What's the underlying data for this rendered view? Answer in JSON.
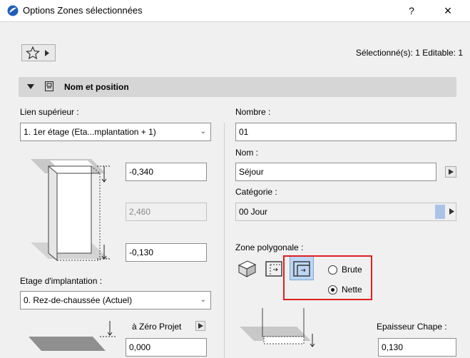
{
  "window": {
    "title": "Options Zones sélectionnées",
    "help": "?",
    "close": "×"
  },
  "toolbar": {
    "selection_info": "Sélectionné(s): 1 Editable: 1"
  },
  "section": {
    "title": "Nom et position"
  },
  "left": {
    "top_link_label": "Lien supérieur :",
    "top_link_value": "1. 1er étage (Eta...mplantation + 1)",
    "top_offset": "-0,340",
    "height": "2,460",
    "bottom_offset": "-0,130",
    "home_story_label": "Etage d'implantation :",
    "home_story_value": "0. Rez-de-chaussée (Actuel)",
    "to_zero_label": "à Zéro Projet",
    "to_zero_value": "0,000"
  },
  "right": {
    "number_label": "Nombre :",
    "number_value": "01",
    "name_label": "Nom :",
    "name_value": "Séjour",
    "category_label": "Catégorie :",
    "category_value": "00  Jour",
    "polygon_label": "Zone polygonale :",
    "radio_brute": "Brute",
    "radio_nette": "Nette",
    "screed_label": "Epaisseur Chape :",
    "screed_value": "0,130"
  },
  "colors": {
    "accent_highlight": "#bcd6f3",
    "callout_red": "#e02020",
    "category_swatch": "#aac4e8"
  }
}
